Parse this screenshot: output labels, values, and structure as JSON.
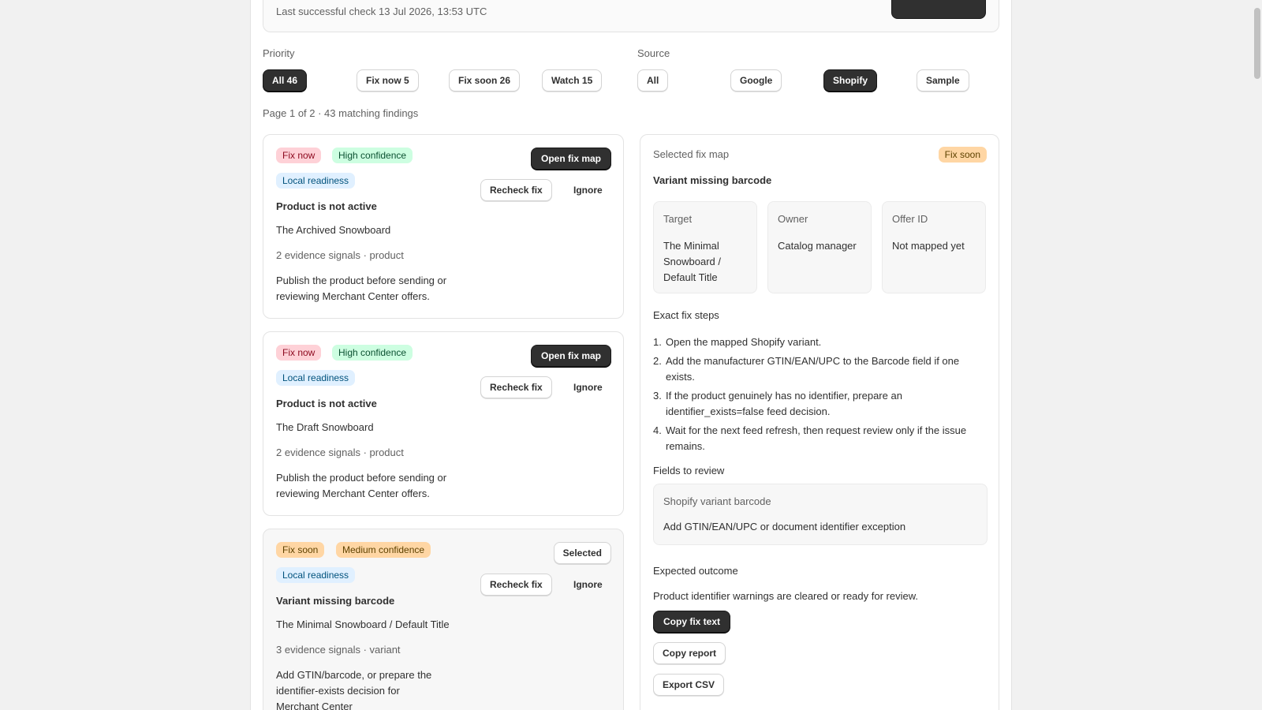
{
  "status": {
    "last_check": "Last successful check 13 Jul 2026, 13:53 UTC"
  },
  "filters": {
    "priority_label": "Priority",
    "priority_options": [
      "All 46",
      "Fix now 5",
      "Fix soon 26",
      "Watch 15"
    ],
    "priority_selected": "All 46",
    "source_label": "Source",
    "source_options": [
      "All",
      "Google",
      "Shopify",
      "Sample"
    ],
    "source_selected": "Shopify"
  },
  "page_info": "Page 1 of 2 · 43 matching findings",
  "findings": [
    {
      "priority": "Fix now",
      "confidence": "High confidence",
      "category": "Local readiness",
      "title": "Product is not active",
      "target": "The Archived Snowboard",
      "evidence": "2 evidence signals · product",
      "description": "Publish the product before sending or reviewing Merchant Center offers.",
      "primary_action": "Open fix map",
      "recheck_label": "Recheck fix",
      "ignore_label": "Ignore"
    },
    {
      "priority": "Fix now",
      "confidence": "High confidence",
      "category": "Local readiness",
      "title": "Product is not active",
      "target": "The Draft Snowboard",
      "evidence": "2 evidence signals · product",
      "description": "Publish the product before sending or reviewing Merchant Center offers.",
      "primary_action": "Open fix map",
      "recheck_label": "Recheck fix",
      "ignore_label": "Ignore"
    },
    {
      "priority": "Fix soon",
      "confidence": "Medium confidence",
      "category": "Local readiness",
      "title": "Variant missing barcode",
      "target": "The Minimal Snowboard / Default Title",
      "evidence": "3 evidence signals · variant",
      "description": "Add GTIN/barcode, or prepare the identifier-exists decision for Merchant Center",
      "primary_action": "Selected",
      "recheck_label": "Recheck fix",
      "ignore_label": "Ignore"
    }
  ],
  "detail": {
    "heading": "Selected fix map",
    "priority_badge": "Fix soon",
    "title": "Variant missing barcode",
    "info": [
      {
        "label": "Target",
        "value": "The Minimal Snowboard / Default Title"
      },
      {
        "label": "Owner",
        "value": "Catalog manager"
      },
      {
        "label": "Offer ID",
        "value": "Not mapped yet"
      }
    ],
    "steps_label": "Exact fix steps",
    "steps": [
      "Open the mapped Shopify variant.",
      "Add the manufacturer GTIN/EAN/UPC to the Barcode field if one exists.",
      "If the product genuinely has no identifier, prepare an identifier_exists=false feed decision.",
      "Wait for the next feed refresh, then request review only if the issue remains."
    ],
    "fields_label": "Fields to review",
    "field_name": "Shopify variant barcode",
    "field_value": "Add GTIN/EAN/UPC or document identifier exception",
    "outcome_label": "Expected outcome",
    "outcome_text": "Product identifier warnings are cleared or ready for review.",
    "copy_fix_label": "Copy fix text",
    "copy_report_label": "Copy report",
    "export_csv_label": "Export CSV"
  }
}
